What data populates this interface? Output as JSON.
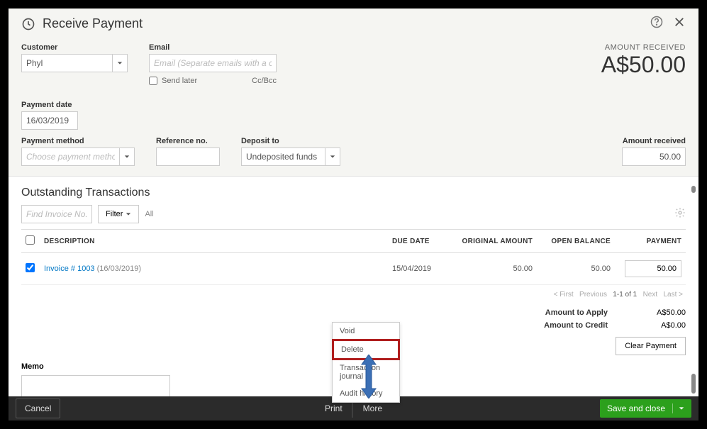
{
  "header": {
    "title": "Receive Payment"
  },
  "amount_received_label": "AMOUNT RECEIVED",
  "amount_received_value": "A$50.00",
  "customer": {
    "label": "Customer",
    "value": "Phyl"
  },
  "email": {
    "label": "Email",
    "placeholder": "Email (Separate emails with a comma)",
    "send_later": "Send later",
    "ccbcc": "Cc/Bcc"
  },
  "payment_date": {
    "label": "Payment date",
    "value": "16/03/2019"
  },
  "payment_method": {
    "label": "Payment method",
    "placeholder": "Choose payment method"
  },
  "reference_no": {
    "label": "Reference no."
  },
  "deposit_to": {
    "label": "Deposit to",
    "value": "Undeposited funds"
  },
  "amount_received_field": {
    "label": "Amount received",
    "value": "50.00"
  },
  "outstanding": {
    "title": "Outstanding Transactions",
    "find_placeholder": "Find Invoice No.",
    "filter_label": "Filter",
    "all_label": "All",
    "columns": {
      "description": "DESCRIPTION",
      "due_date": "DUE DATE",
      "original_amount": "ORIGINAL AMOUNT",
      "open_balance": "OPEN BALANCE",
      "payment": "PAYMENT"
    },
    "rows": [
      {
        "checked": true,
        "link": "Invoice # 1003",
        "link_date": "(16/03/2019)",
        "due_date": "15/04/2019",
        "original_amount": "50.00",
        "open_balance": "50.00",
        "payment": "50.00"
      }
    ],
    "pager": {
      "first": "< First",
      "previous": "Previous",
      "range": "1-1 of 1",
      "next": "Next",
      "last": "Last >"
    }
  },
  "totals": {
    "apply_label": "Amount to Apply",
    "apply_value": "A$50.00",
    "credit_label": "Amount to Credit",
    "credit_value": "A$0.00",
    "clear_label": "Clear Payment"
  },
  "memo_label": "Memo",
  "popup": {
    "void": "Void",
    "delete": "Delete",
    "journal": "Transaction journal",
    "audit": "Audit history"
  },
  "footer": {
    "cancel": "Cancel",
    "print": "Print",
    "more": "More",
    "save": "Save and close"
  }
}
